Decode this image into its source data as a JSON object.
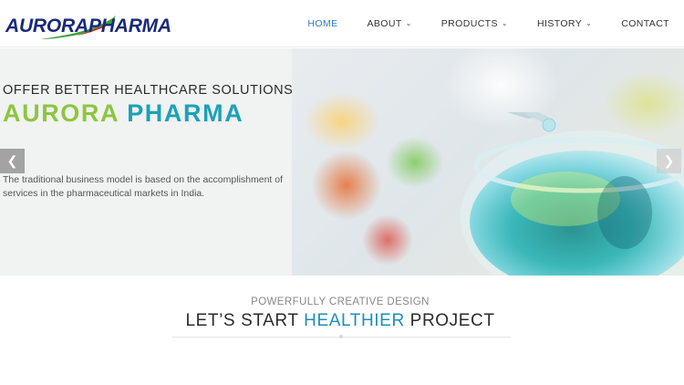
{
  "brand": {
    "name_part1": "AURORA",
    "name_part2": "PHARMA"
  },
  "nav": {
    "items": [
      {
        "label": "HOME",
        "active": true,
        "has_dropdown": false
      },
      {
        "label": "ABOUT",
        "active": false,
        "has_dropdown": true
      },
      {
        "label": "PRODUCTS",
        "active": false,
        "has_dropdown": true
      },
      {
        "label": "HISTORY",
        "active": false,
        "has_dropdown": true
      },
      {
        "label": "CONTACT",
        "active": false,
        "has_dropdown": false
      }
    ]
  },
  "hero": {
    "kicker": "OFFER BETTER HEALTHCARE SOLUTIONS",
    "title_part1": "AURORA",
    "title_part2": "PHARMA",
    "description": "The traditional business model is based on the accomplishment of services in the pharmaceutical markets in India.",
    "prev_icon": "chevron-left-icon",
    "next_icon": "chevron-right-icon"
  },
  "section": {
    "subtitle": "POWERFULLY CREATIVE DESIGN",
    "title_part1": "LET’S START",
    "title_highlight": "HEALTHIER",
    "title_part2": "PROJECT"
  },
  "colors": {
    "nav_active": "#2a7fc8",
    "title_green": "#8cc63f",
    "title_teal": "#1ba2b7",
    "brand_navy": "#1a2a7a",
    "logo_green": "#3aa53a",
    "highlight_blue": "#1c8fb8"
  }
}
